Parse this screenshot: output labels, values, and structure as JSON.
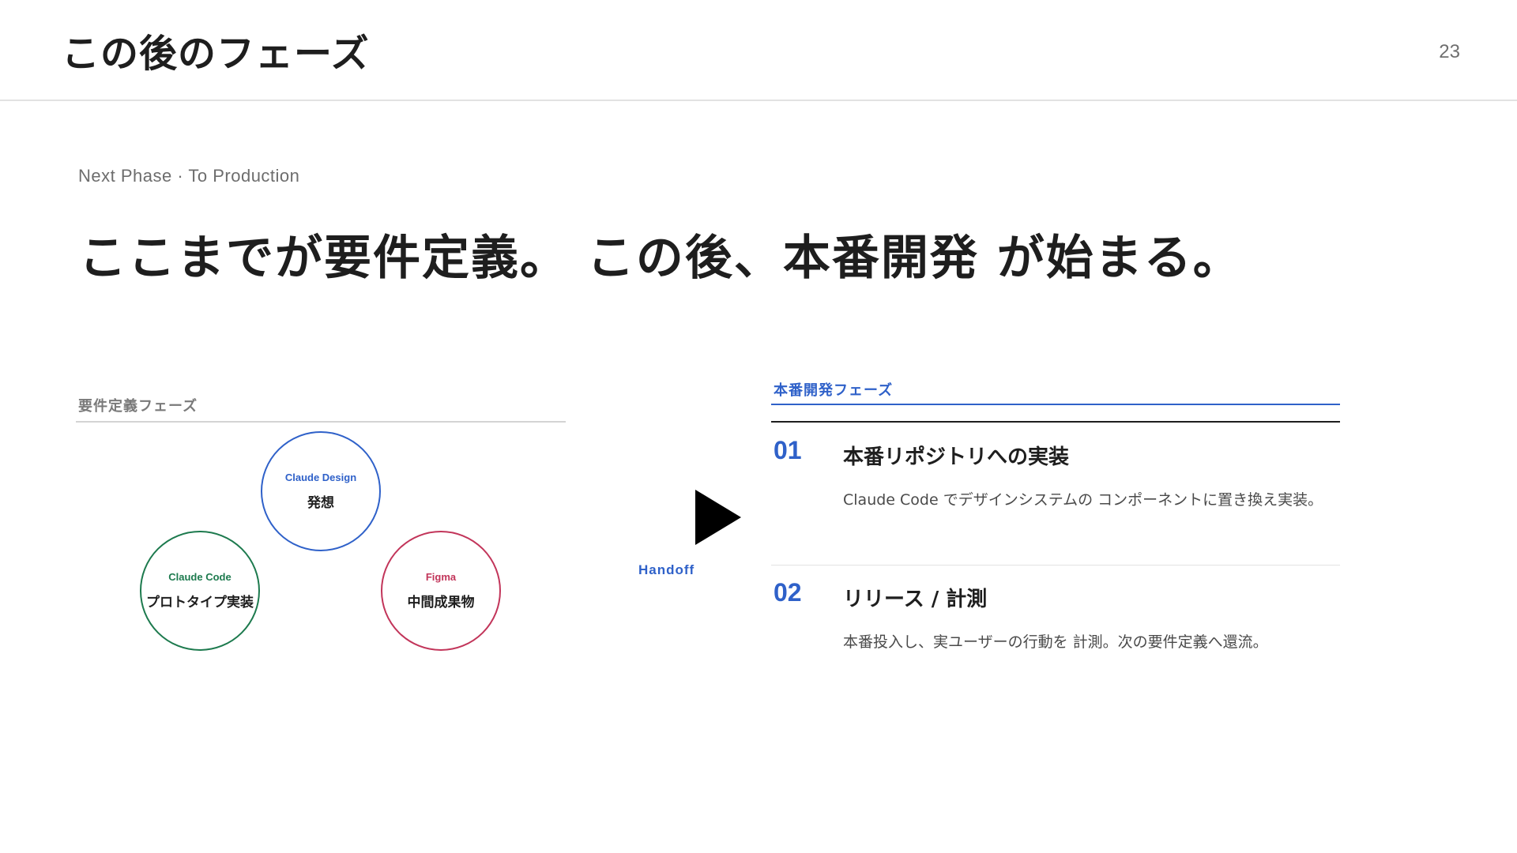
{
  "header": {
    "title": "この後のフェーズ",
    "page_number": "23"
  },
  "intro": {
    "eyebrow": "Next Phase · To Production",
    "headline": "ここまでが要件定義。 この後、本番開発 が始まる。"
  },
  "requirements_phase": {
    "label": "要件定義フェーズ",
    "circles": [
      {
        "tool": "Claude Design",
        "role": "発想",
        "color": "#2f61c9"
      },
      {
        "tool": "Claude Code",
        "role": "プロトタイプ実装",
        "color": "#1d7a4e"
      },
      {
        "tool": "Figma",
        "role": "中間成果物",
        "color": "#c2355a"
      }
    ]
  },
  "transition": {
    "label": "Handoff",
    "arrow_icon": "play-arrow-icon"
  },
  "production_phase": {
    "label": "本番開発フェーズ",
    "steps": [
      {
        "number": "01",
        "title": "本番リポジトリへの実装",
        "description": "Claude Code でデザインシステムの コンポーネントに置き換え実装。"
      },
      {
        "number": "02",
        "title": "リリース / 計測",
        "description": "本番投入し、実ユーザーの行動を 計測。次の要件定義へ還流。"
      }
    ]
  },
  "colors": {
    "accent_blue": "#2f61c9",
    "accent_green": "#1d7a4e",
    "accent_red": "#c2355a",
    "text_dark": "#1e1e1e"
  }
}
